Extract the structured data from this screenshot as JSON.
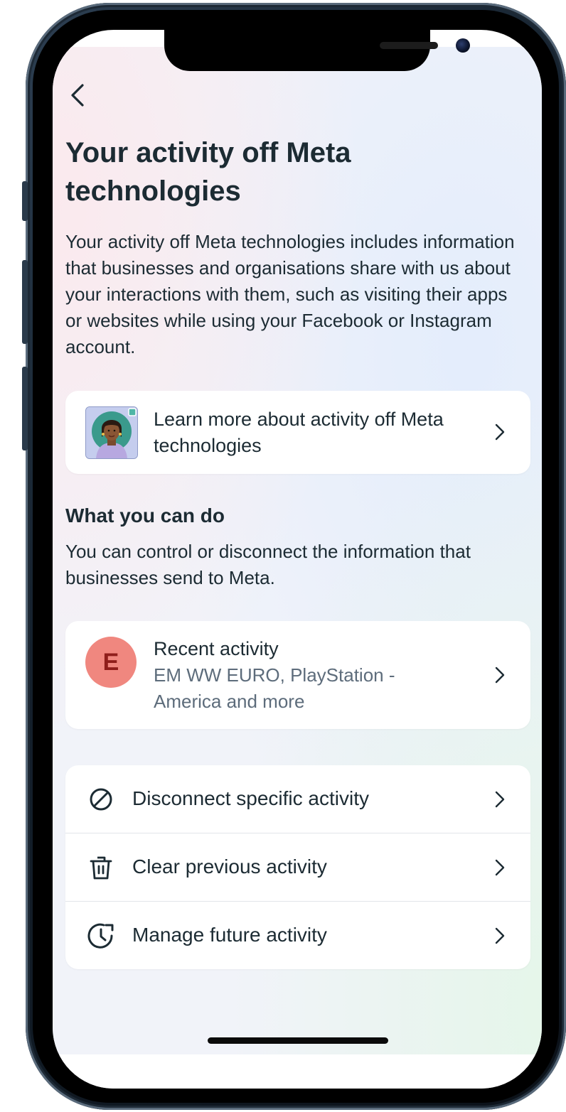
{
  "page": {
    "title": "Your activity off Meta technologies",
    "description": "Your activity off Meta technologies includes information that businesses and organisations share with us about your interactions with them, such as visiting their apps or websites while using your Facebook or Instagram account."
  },
  "learn_card": {
    "label": "Learn more about activity off Meta technologies"
  },
  "section": {
    "heading": "What you can do",
    "text": "You can control or disconnect the information that businesses send to Meta."
  },
  "recent": {
    "avatar_letter": "E",
    "title": "Recent activity",
    "subtitle": "EM WW EURO, PlayStation - America and more"
  },
  "actions": [
    {
      "label": "Disconnect specific activity",
      "icon": "prohibited-icon"
    },
    {
      "label": "Clear previous activity",
      "icon": "trash-icon"
    },
    {
      "label": "Manage future activity",
      "icon": "clock-arrow-icon"
    }
  ],
  "colors": {
    "text_primary": "#1c2b33",
    "text_secondary": "#5d6c7b",
    "avatar_bg": "#f0877f",
    "avatar_letter": "#8f1e1b"
  }
}
